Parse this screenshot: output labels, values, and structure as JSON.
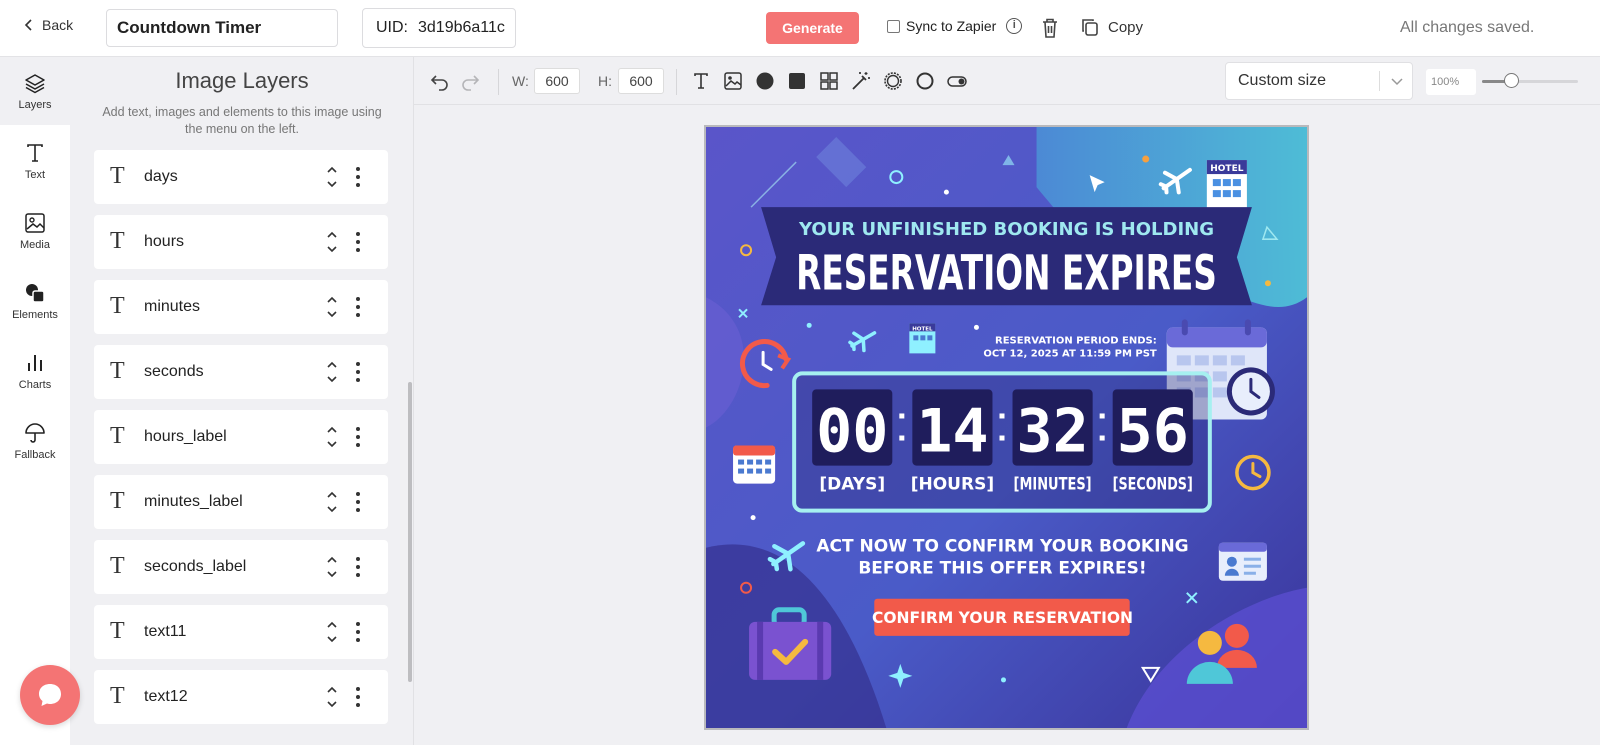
{
  "topbar": {
    "back_label": "Back",
    "template_name": "Countdown Timer",
    "uid_label": "UID:",
    "uid_value": "3d19b6a11c",
    "generate_label": "Generate",
    "sync_label": "Sync to Zapier",
    "copy_label": "Copy",
    "saved_status": "All changes saved."
  },
  "rail": {
    "items": [
      {
        "label": "Layers",
        "icon": "layers-icon"
      },
      {
        "label": "Text",
        "icon": "text-icon"
      },
      {
        "label": "Media",
        "icon": "image-icon"
      },
      {
        "label": "Elements",
        "icon": "shapes-icon"
      },
      {
        "label": "Charts",
        "icon": "bar-chart-icon"
      },
      {
        "label": "Fallback",
        "icon": "umbrella-icon"
      }
    ]
  },
  "panel": {
    "title": "Image Layers",
    "subtitle": "Add text, images and elements to this image using the menu on the left.",
    "layers": [
      "days",
      "hours",
      "minutes",
      "seconds",
      "hours_label",
      "minutes_label",
      "seconds_label",
      "text11",
      "text12"
    ]
  },
  "toolbar": {
    "width_label": "W:",
    "width_value": "600",
    "height_label": "H:",
    "height_value": "600",
    "size_select": "Custom size",
    "zoom": "100%",
    "zoom_fraction": 0.3
  },
  "artwork": {
    "headline_small": "YOUR UNFINISHED BOOKING IS HOLDING",
    "headline_big": "RESERVATION EXPIRES",
    "hotel_sign": "HOTEL",
    "hotel_small": "HOTEL",
    "period_line1": "RESERVATION PERIOD ENDS:",
    "period_line2": "OCT 12, 2025 AT 11:59 PM PST",
    "days": "00",
    "hours": "14",
    "minutes": "32",
    "seconds": "56",
    "days_label": "[DAYS]",
    "hours_label": "[HOURS]",
    "minutes_label": "[MINUTES]",
    "seconds_label": "[SECONDS]",
    "cta_line1": "ACT NOW TO CONFIRM YOUR BOOKING",
    "cta_line2": "BEFORE THIS OFFER EXPIRES!",
    "button_label": "CONFIRM YOUR RESERVATION",
    "colors": {
      "bg_top": "#4fb3d9",
      "bg_bottom": "#3f3aa8",
      "banner": "#2b2a78",
      "accent": "#f25a4a",
      "digit_box": "#1f1d5c",
      "frame": "#a6f0f0"
    }
  }
}
